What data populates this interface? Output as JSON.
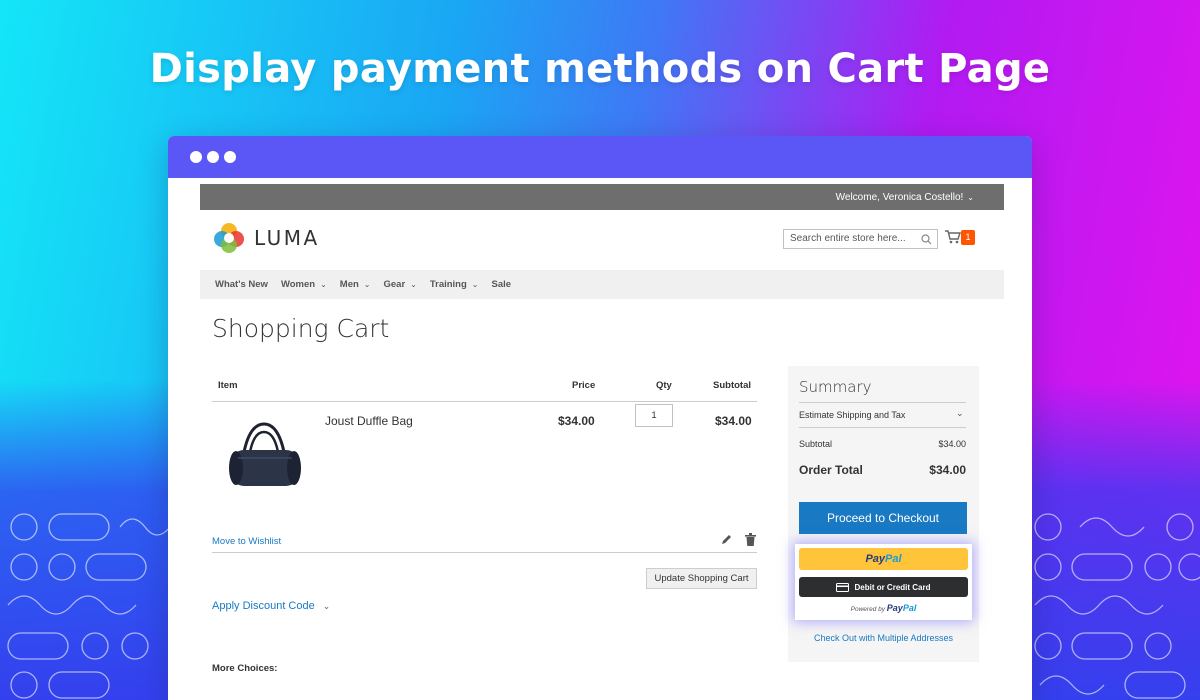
{
  "headline": "Display payment methods on Cart Page",
  "store": {
    "welcome": "Welcome, Veronica Costello!",
    "logo_text": "LUMA",
    "search_placeholder": "Search entire store here...",
    "cart_count": "1",
    "nav": [
      "What's New",
      "Women",
      "Men",
      "Gear",
      "Training",
      "Sale"
    ]
  },
  "cart": {
    "title": "Shopping Cart",
    "headers": {
      "item": "Item",
      "price": "Price",
      "qty": "Qty",
      "subtotal": "Subtotal"
    },
    "product": {
      "name": "Joust Duffle Bag",
      "price": "$34.00",
      "qty": "1",
      "subtotal": "$34.00"
    },
    "move_to_wishlist": "Move to Wishlist",
    "update_button": "Update Shopping Cart",
    "discount": "Apply Discount Code",
    "more_choices": "More Choices:"
  },
  "summary": {
    "title": "Summary",
    "estimate": "Estimate Shipping and Tax",
    "subtotal_label": "Subtotal",
    "subtotal_value": "$34.00",
    "order_total_label": "Order Total",
    "order_total_value": "$34.00",
    "checkout_button": "Proceed to Checkout",
    "paypal_pay": "Pay",
    "paypal_pal": "Pal",
    "card_button": "Debit or Credit Card",
    "powered_by": "Powered by",
    "multi_address": "Check Out with Multiple Addresses"
  },
  "colors": {
    "window_bar": "#5b57f6",
    "link": "#1979c3",
    "paypal_yellow": "#ffc439",
    "cart_badge": "#ff5501"
  }
}
